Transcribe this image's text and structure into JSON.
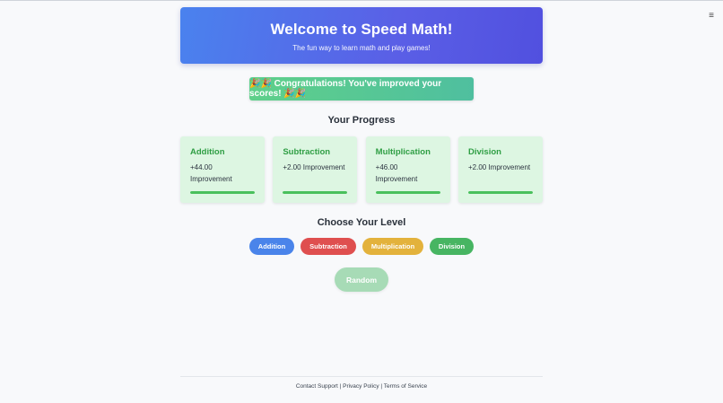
{
  "menu": {
    "icon": "menu-icon",
    "glyph": "≡"
  },
  "hero": {
    "title": "Welcome to Speed Math!",
    "subtitle": "The fun way to learn math and play games!"
  },
  "congrats": {
    "text": "🎉🎉 Congratulations! You've improved your scores! 🎉🎉"
  },
  "progress": {
    "title": "Your Progress",
    "cards": [
      {
        "name": "Addition",
        "improvement": "+44.00 Improvement",
        "fill": 1.0
      },
      {
        "name": "Subtraction",
        "improvement": "+2.00 Improvement",
        "fill": 1.0
      },
      {
        "name": "Multiplication",
        "improvement": "+46.00 Improvement",
        "fill": 1.0
      },
      {
        "name": "Division",
        "improvement": "+2.00 Improvement",
        "fill": 1.0
      }
    ]
  },
  "levels": {
    "title": "Choose Your Level",
    "options": [
      {
        "label": "Addition",
        "color": "#4a84ea"
      },
      {
        "label": "Subtraction",
        "color": "#df4f4f"
      },
      {
        "label": "Multiplication",
        "color": "#e3b23c"
      },
      {
        "label": "Division",
        "color": "#47b562"
      }
    ],
    "random_label": "Random"
  },
  "footer": {
    "links": [
      "Contact Support",
      "Privacy Policy",
      "Terms of Service"
    ],
    "separator": " | "
  }
}
